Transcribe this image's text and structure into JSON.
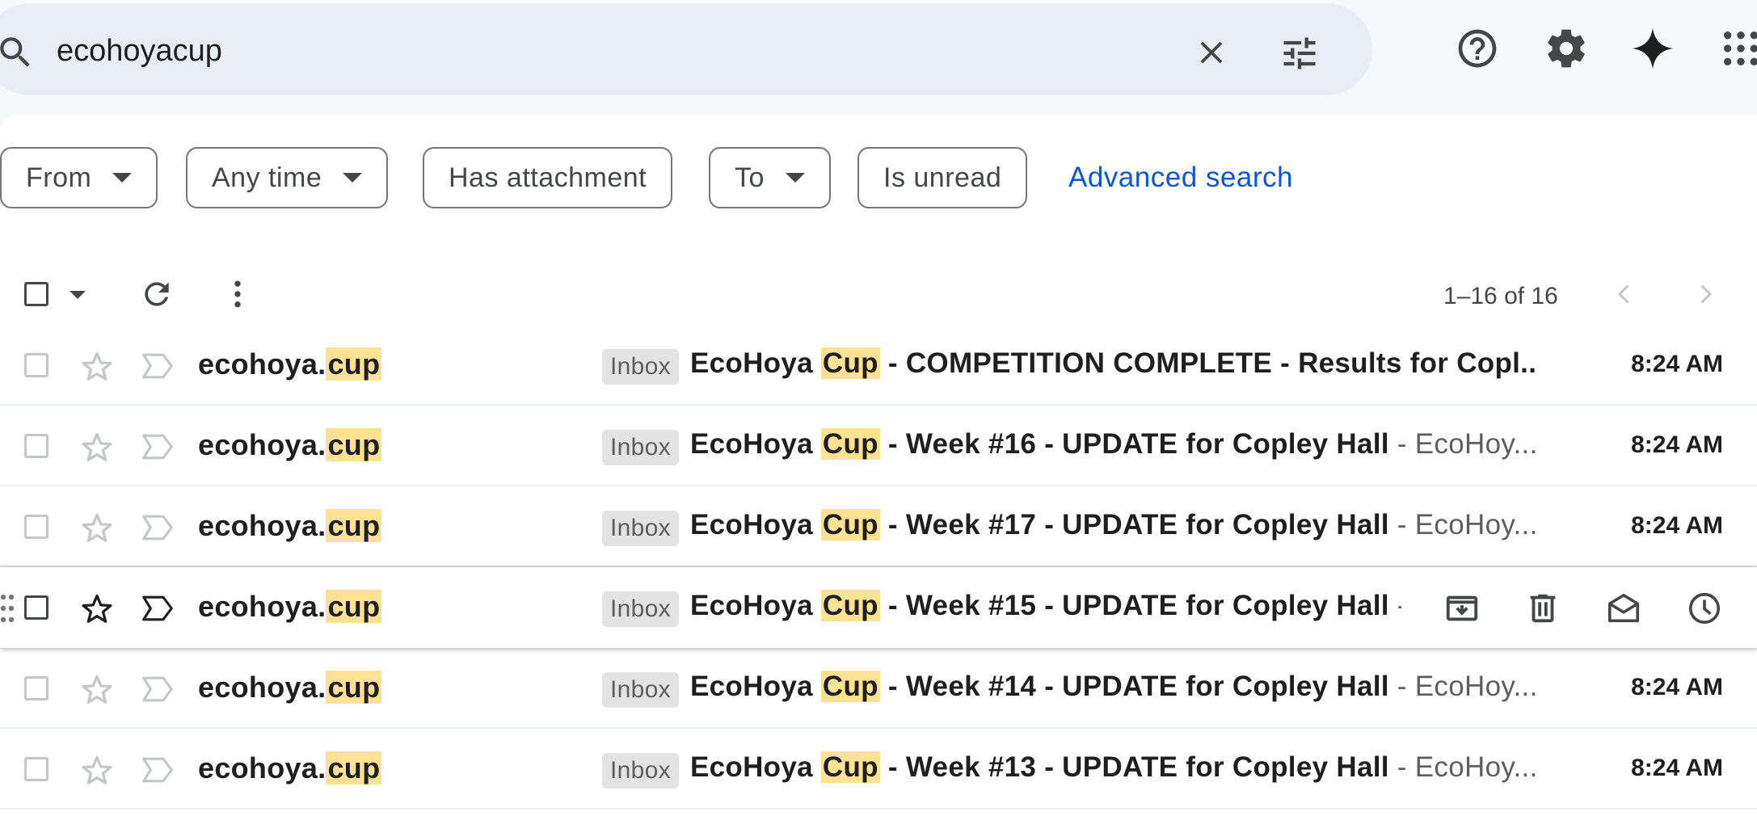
{
  "search": {
    "query": "ecohoyacup"
  },
  "filters": {
    "chips": [
      {
        "label": "From",
        "dropdown": true
      },
      {
        "label": "Any time",
        "dropdown": true
      },
      {
        "label": "Has attachment",
        "dropdown": false
      },
      {
        "label": "To",
        "dropdown": true
      },
      {
        "label": "Is unread",
        "dropdown": false
      }
    ],
    "advanced_search": "Advanced search"
  },
  "toolbar": {
    "page_count": "1–16 of 16"
  },
  "emails": [
    {
      "sender_prefix": "ecohoya.",
      "sender_highlight": "cup",
      "badge": "Inbox",
      "subject_prefix": "EcoHoya ",
      "subject_highlight": "Cup",
      "subject_rest": " - COMPETITION COMPLETE - Results for Copl...",
      "snippet": "",
      "time": "8:24 AM"
    },
    {
      "sender_prefix": "ecohoya.",
      "sender_highlight": "cup",
      "badge": "Inbox",
      "subject_prefix": "EcoHoya ",
      "subject_highlight": "Cup",
      "subject_rest": " - Week #16 - UPDATE for Copley Hall",
      "snippet": " - EcoHoy...",
      "time": "8:24 AM"
    },
    {
      "sender_prefix": "ecohoya.",
      "sender_highlight": "cup",
      "badge": "Inbox",
      "subject_prefix": "EcoHoya ",
      "subject_highlight": "Cup",
      "subject_rest": " - Week #17 - UPDATE for Copley Hall",
      "snippet": " - EcoHoy...",
      "time": "8:24 AM"
    },
    {
      "sender_prefix": "ecohoya.",
      "sender_highlight": "cup",
      "badge": "Inbox",
      "subject_prefix": "EcoHoya ",
      "subject_highlight": "Cup",
      "subject_rest": " - Week #15 - UPDATE for Copley Hall",
      "snippet": " -",
      "time": ""
    },
    {
      "sender_prefix": "ecohoya.",
      "sender_highlight": "cup",
      "badge": "Inbox",
      "subject_prefix": "EcoHoya ",
      "subject_highlight": "Cup",
      "subject_rest": " - Week #14 - UPDATE for Copley Hall",
      "snippet": " - EcoHoy...",
      "time": "8:24 AM"
    },
    {
      "sender_prefix": "ecohoya.",
      "sender_highlight": "cup",
      "badge": "Inbox",
      "subject_prefix": "EcoHoya ",
      "subject_highlight": "Cup",
      "subject_rest": " - Week #13 - UPDATE for Copley Hall",
      "snippet": " - EcoHoy...",
      "time": "8:24 AM"
    }
  ],
  "colors": {
    "highlight": "#fde293",
    "link": "#0b57d0",
    "search_bg": "#e9eef6",
    "page_bg": "#f6f8fc"
  },
  "icons": {
    "header": [
      "search-icon",
      "close-icon",
      "tune-icon",
      "help-icon",
      "gear-icon",
      "sparkle-icon",
      "apps-grid-icon"
    ],
    "row": [
      "checkbox",
      "star-icon",
      "label-icon"
    ],
    "hover_actions": [
      "archive-icon",
      "delete-icon",
      "mark-read-icon",
      "snooze-icon"
    ]
  }
}
